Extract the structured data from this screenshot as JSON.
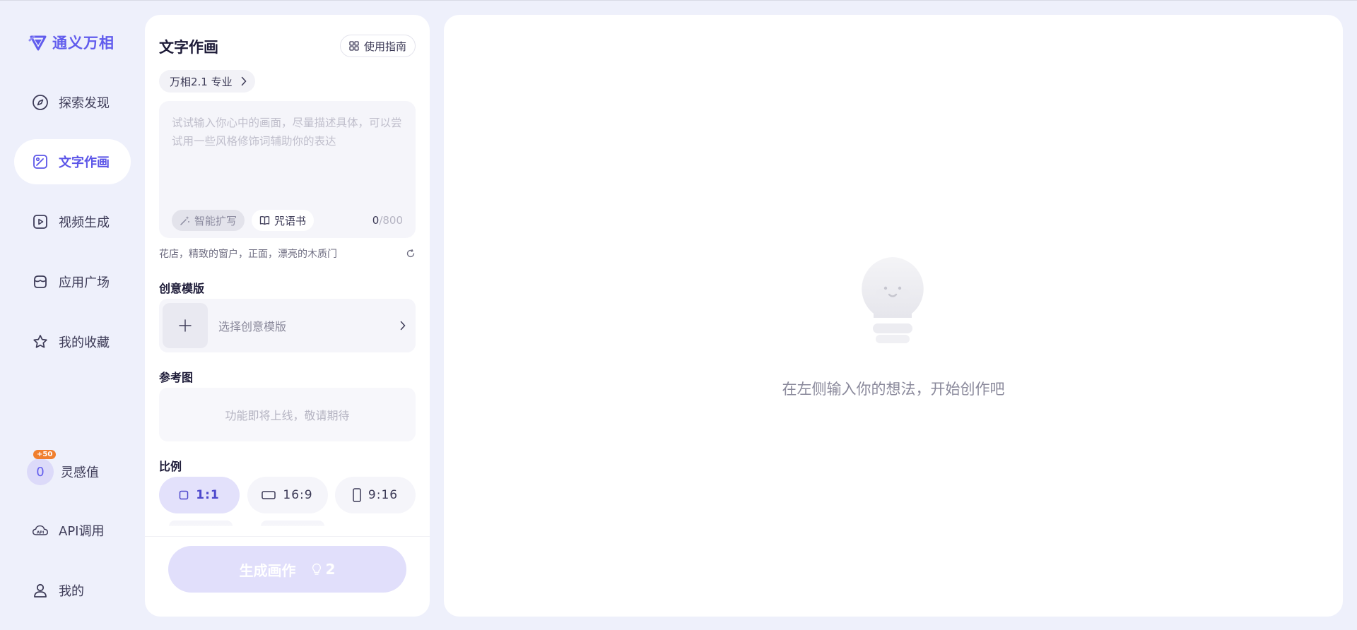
{
  "app": {
    "name": "通义万相"
  },
  "nav": {
    "items": [
      {
        "label": "探索发现",
        "icon": "compass-icon"
      },
      {
        "label": "文字作画",
        "icon": "image-edit-icon",
        "active": true
      },
      {
        "label": "视频生成",
        "icon": "video-play-icon"
      },
      {
        "label": "应用广场",
        "icon": "store-icon"
      },
      {
        "label": "我的收藏",
        "icon": "star-icon"
      }
    ],
    "credit": {
      "value": "0",
      "badge": "+50",
      "label": "灵感值"
    },
    "api": {
      "label": "API调用",
      "icon": "cloud-api-icon"
    },
    "me": {
      "label": "我的",
      "icon": "user-icon"
    }
  },
  "panel": {
    "title": "文字作画",
    "guide_label": "使用指南",
    "model_label": "万相2.1 专业",
    "prompt": {
      "value": "",
      "placeholder": "试试输入你心中的画面，尽量描述具体，可以尝试用一些风格修饰词辅助你的表达"
    },
    "expand_label": "智能扩写",
    "spellbook_label": "咒语书",
    "counter_current": "0",
    "counter_max": "/800",
    "hint": "花店，精致的窗户，正面，漂亮的木质门",
    "template_section": "创意模版",
    "template_placeholder": "选择创意模版",
    "reference_section": "参考图",
    "reference_text": "功能即将上线，敬请期待",
    "ratio_section": "比例",
    "ratios": [
      {
        "label": "1:1",
        "active": true
      },
      {
        "label": "16:9",
        "active": false
      },
      {
        "label": "9:16",
        "active": false
      }
    ],
    "generate_label": "生成画作",
    "generate_cost": "2"
  },
  "canvas": {
    "empty_text": "在左侧输入你的想法，开始创作吧"
  },
  "colors": {
    "accent": "#615ced",
    "background": "#eef0fb",
    "badge": "#f07f2e",
    "generate_disabled": "#e1dffb"
  }
}
